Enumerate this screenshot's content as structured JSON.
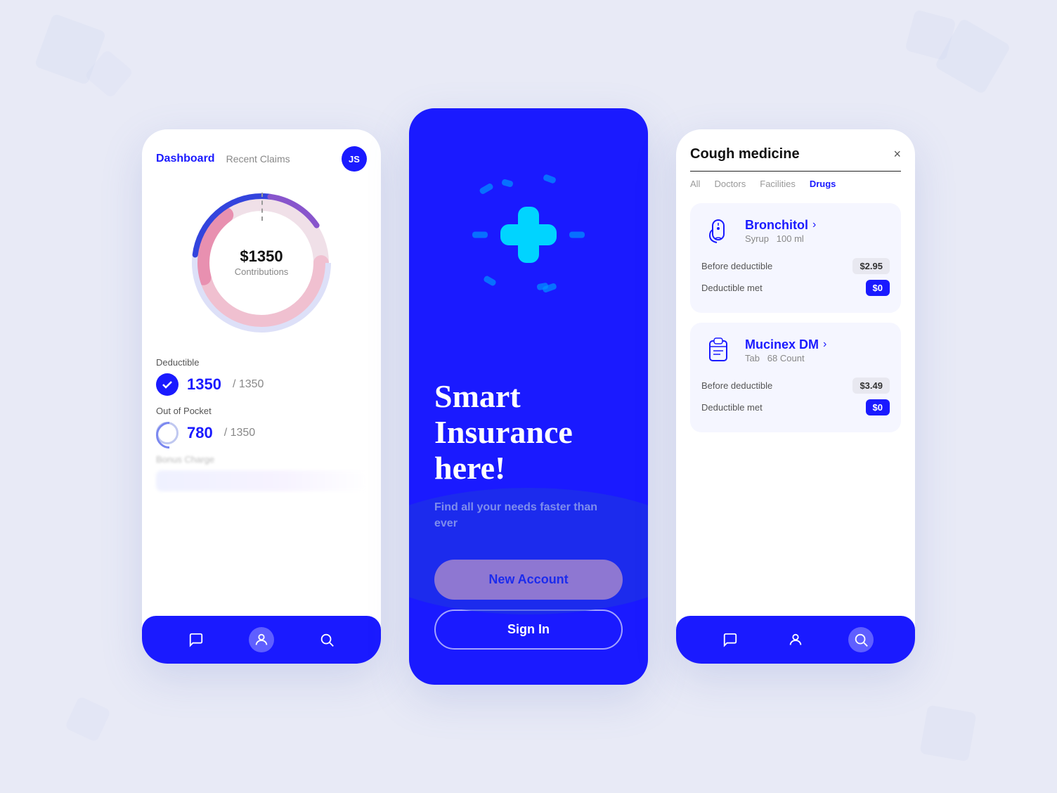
{
  "background": {
    "color": "#e8eaf6"
  },
  "phone1": {
    "title": "Dashboard",
    "tab2": "Recent Claims",
    "avatar": "JS",
    "chart": {
      "amount": "$1350",
      "label": "Contributions"
    },
    "deductible": {
      "section_label": "Deductible",
      "value": "1350",
      "max": "/ 1350"
    },
    "out_of_pocket": {
      "section_label": "Out of Pocket",
      "value": "780",
      "max": "/ 1350"
    },
    "bonus_charge": "Bonus Charge"
  },
  "phone2": {
    "title_line1": "Smart",
    "title_line2": "Insurance",
    "title_line3": "here!",
    "subtitle": "Find all your needs faster than ever",
    "btn_new_account": "New Account",
    "btn_sign_in": "Sign In"
  },
  "phone3": {
    "title": "Cough medicine",
    "filters": [
      "All",
      "Doctors",
      "Facilities",
      "Drugs"
    ],
    "active_filter": "Drugs",
    "drugs": [
      {
        "name": "Bronchitol",
        "type": "Syrup",
        "amount": "100 ml",
        "before_deductible_label": "Before deductible",
        "before_deductible_value": "$2.95",
        "deductible_met_label": "Deductible met",
        "deductible_met_value": "$0"
      },
      {
        "name": "Mucinex DM",
        "type": "Tab",
        "amount": "68 Count",
        "before_deductible_label": "Before deductible",
        "before_deductible_value": "$3.49",
        "deductible_met_label": "Deductible met",
        "deductible_met_value": "$0"
      }
    ]
  }
}
